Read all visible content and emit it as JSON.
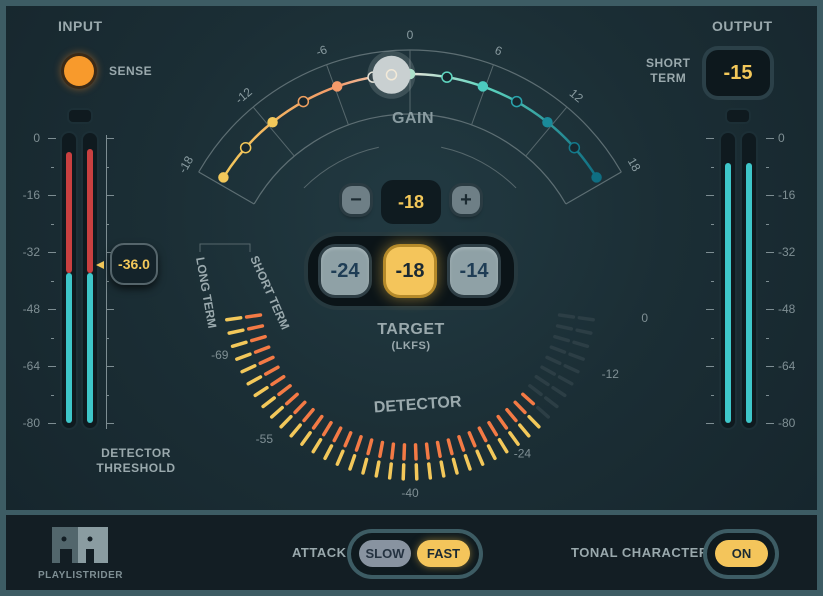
{
  "plugin": {
    "brand": "PLAYLISTRIDER"
  },
  "input": {
    "title": "INPUT",
    "sense_label": "SENSE",
    "sense_led_color": "#f89a2c",
    "scale": [
      "0",
      "-16",
      "-32",
      "-48",
      "-64",
      "-80"
    ],
    "meter_left_level_db": -38,
    "meter_left_peak_db": -4,
    "meter_right_level_db": -38,
    "meter_right_peak_db": -3,
    "threshold_value": "-36.0",
    "threshold_label_line1": "DETECTOR",
    "threshold_label_line2": "THRESHOLD"
  },
  "output": {
    "title": "OUTPUT",
    "short_term_label_line1": "SHORT",
    "short_term_label_line2": "TERM",
    "short_term_value": "-15",
    "scale": [
      "0",
      "-16",
      "-32",
      "-48",
      "-64",
      "-80"
    ],
    "meter_left_level_db": -7,
    "meter_right_level_db": -7
  },
  "gain": {
    "title": "GAIN",
    "scale": [
      "-18",
      "-12",
      "-6",
      "0",
      "6",
      "12",
      "18"
    ],
    "current_db": -1.5,
    "value_display": "-18",
    "minus_label": "−",
    "plus_label": "+"
  },
  "target": {
    "title": "TARGET",
    "unit": "(LKFS)",
    "options": [
      "-24",
      "-18",
      "-14"
    ],
    "selected": "-18"
  },
  "detector": {
    "title": "DETECTOR",
    "long_term_label": "LONG TERM",
    "short_term_label": "SHORT TERM",
    "scale": [
      "-69",
      "-55",
      "-40",
      "-24",
      "-12",
      "0"
    ],
    "short_term_level_db": -15,
    "long_term_level_db": -18,
    "short_color": "#f47a45",
    "long_color": "#f3c85a"
  },
  "footer": {
    "attack_label": "ATTACK",
    "attack_options": [
      "SLOW",
      "FAST"
    ],
    "attack_selected": "FAST",
    "tonal_label": "TONAL CHARACTER",
    "tonal_value": "ON"
  }
}
